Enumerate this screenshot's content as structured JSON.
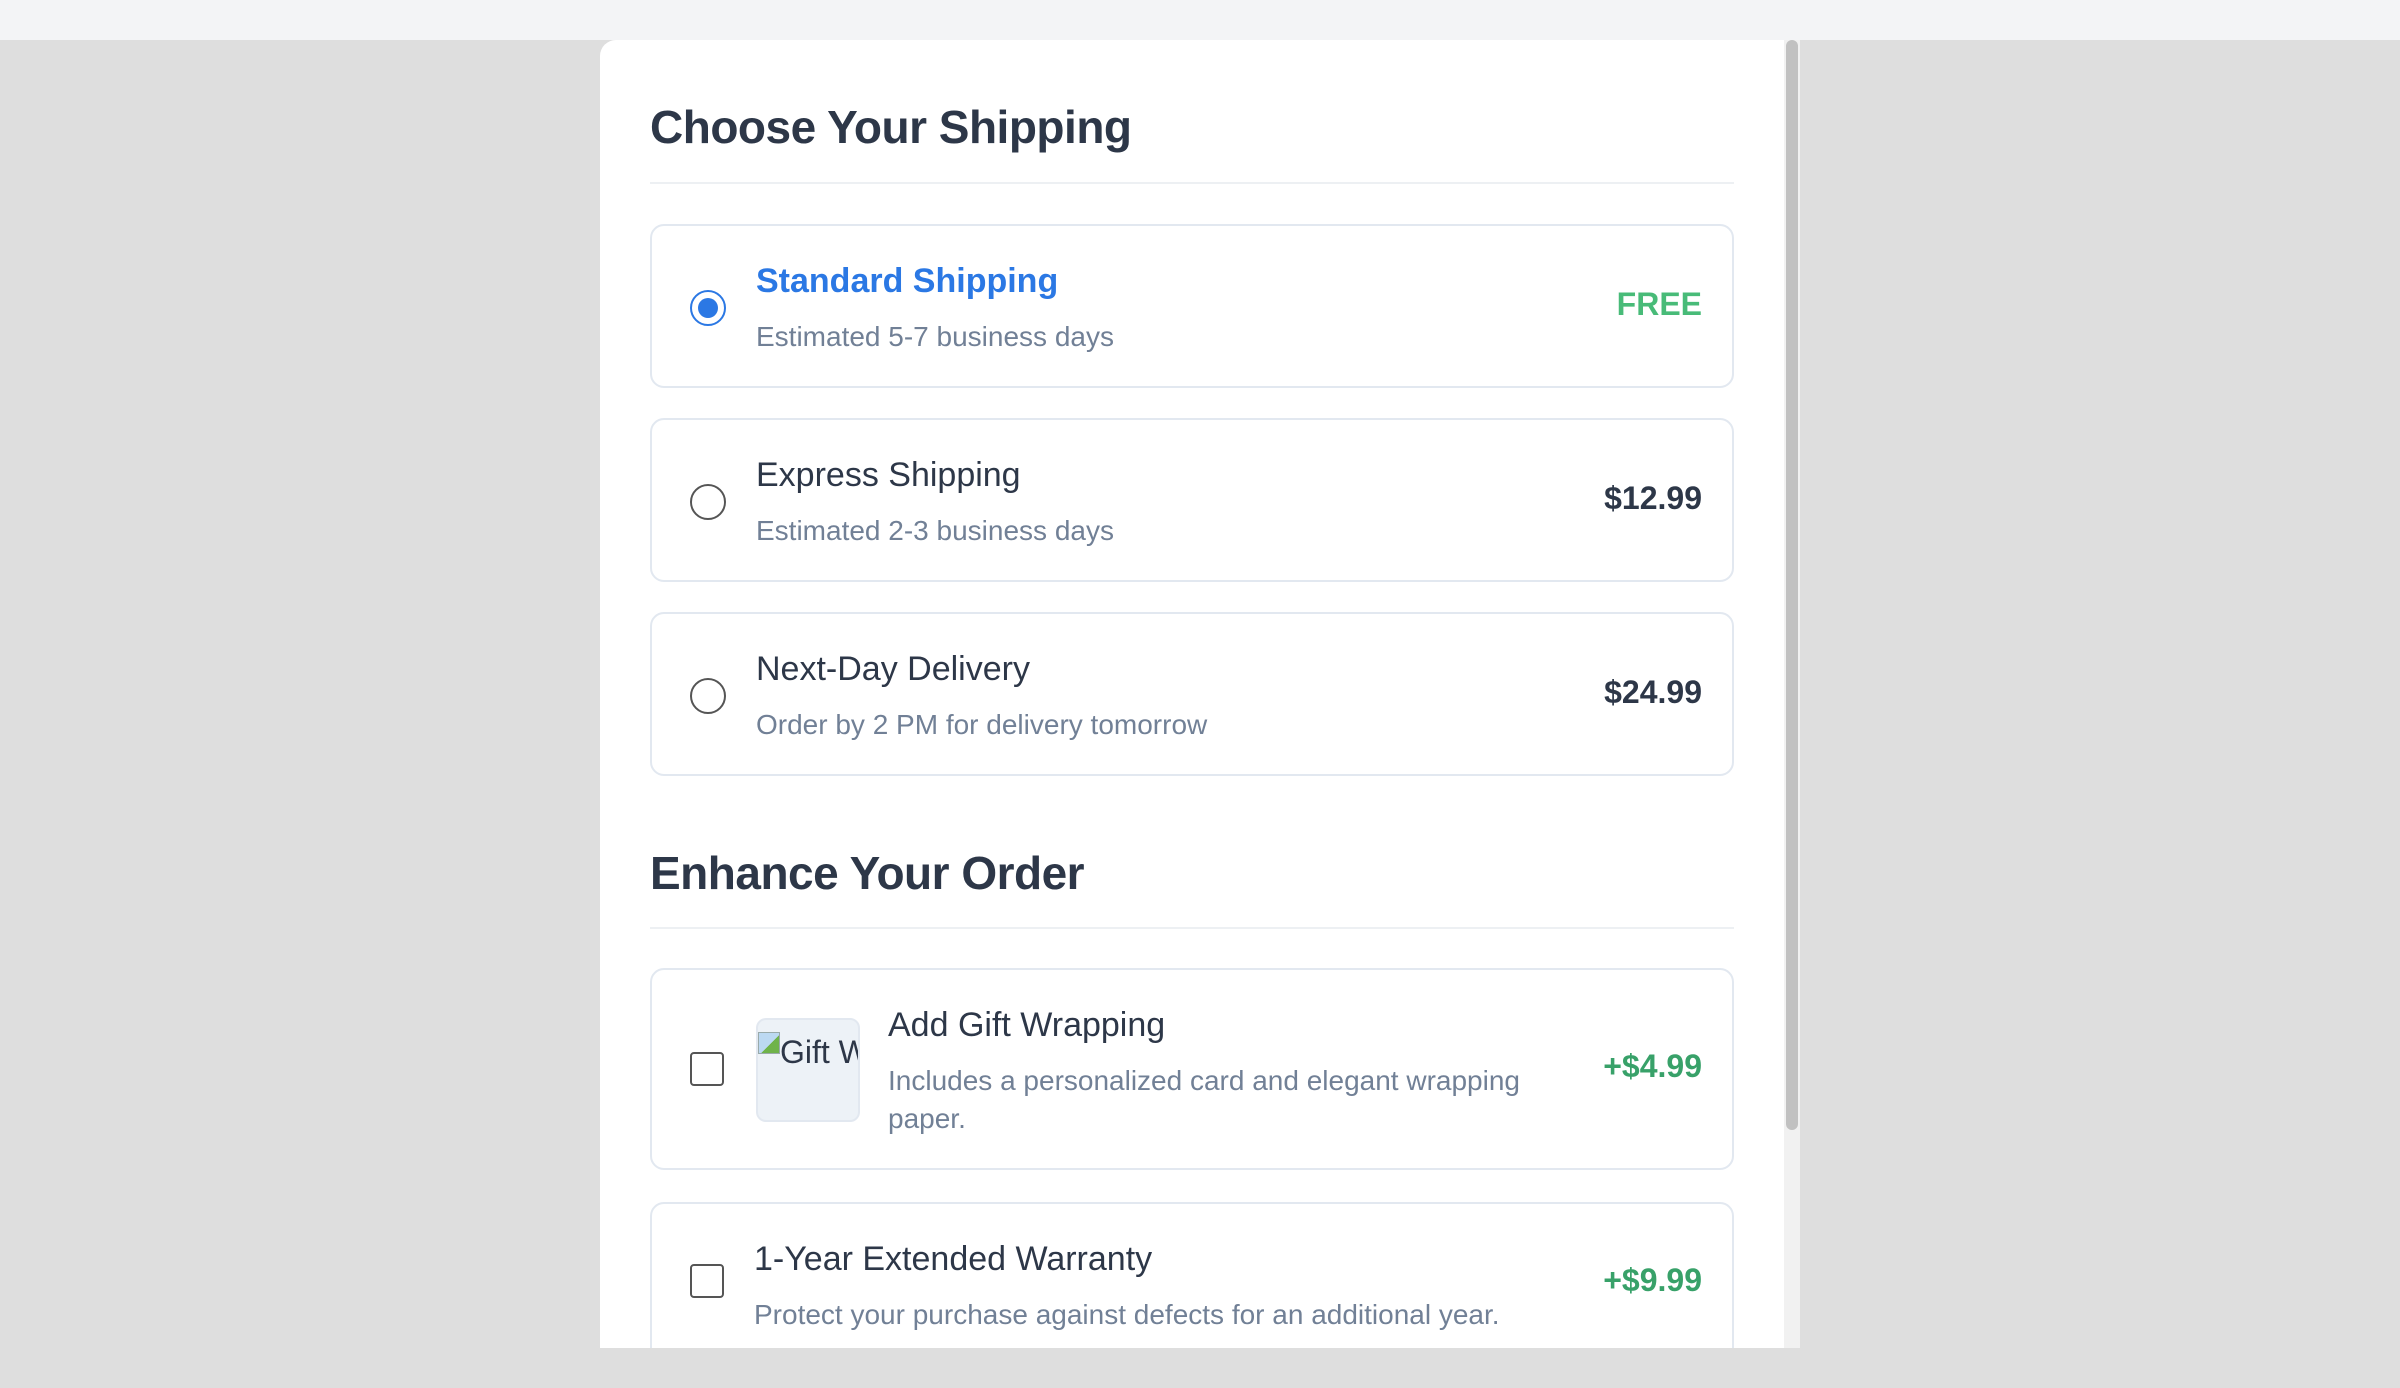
{
  "shipping": {
    "heading": "Choose Your Shipping",
    "options": [
      {
        "title": "Standard Shipping",
        "description": "Estimated 5-7 business days",
        "price": "FREE",
        "selected": true
      },
      {
        "title": "Express Shipping",
        "description": "Estimated 2-3 business days",
        "price": "$12.99",
        "selected": false
      },
      {
        "title": "Next-Day Delivery",
        "description": "Order by 2 PM for delivery tomorrow",
        "price": "$24.99",
        "selected": false
      }
    ]
  },
  "addons": {
    "heading": "Enhance Your Order",
    "items": [
      {
        "title": "Add Gift Wrapping",
        "description": "Includes a personalized card and elegant wrapping paper.",
        "price": "+$4.99",
        "image_alt": "Gift Wrapping",
        "checked": false
      },
      {
        "title": "1-Year Extended Warranty",
        "description": "Protect your purchase against defects for an additional year.",
        "price": "+$9.99",
        "checked": false
      }
    ]
  },
  "colors": {
    "accent": "#2b78e4",
    "free": "#48bb78",
    "addon_price": "#38a169",
    "backdrop": "#dedede"
  }
}
